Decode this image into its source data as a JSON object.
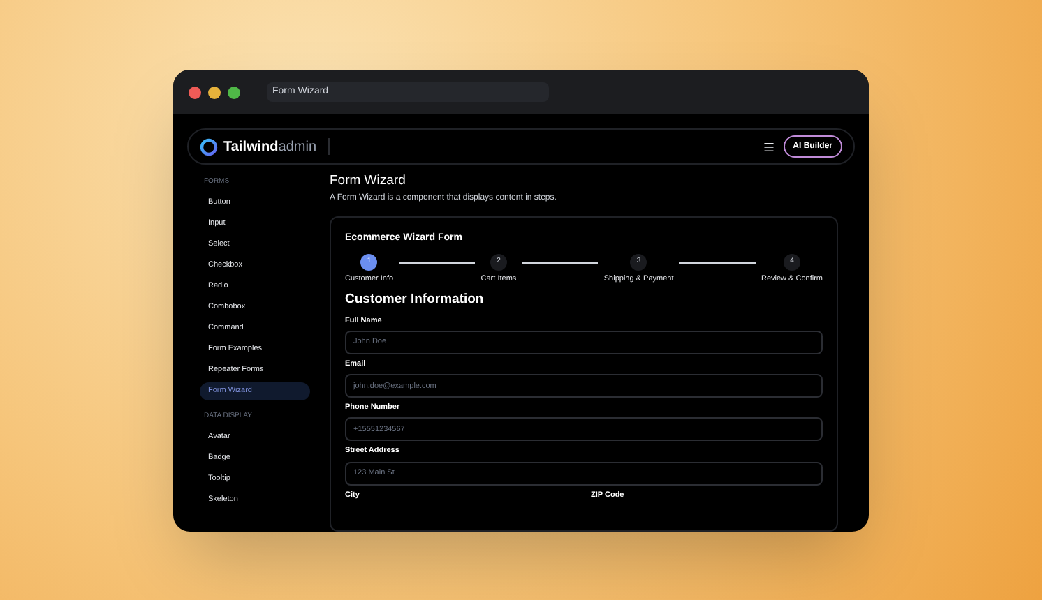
{
  "window": {
    "title": "Form Wizard"
  },
  "header": {
    "logo_bold": "Tailwind",
    "logo_light": "admin",
    "button": "AI Builder"
  },
  "sidebar": {
    "sections": [
      {
        "heading": "FORMS",
        "items": [
          {
            "label": "Button",
            "selected": false
          },
          {
            "label": "Input",
            "selected": false
          },
          {
            "label": "Select",
            "selected": false
          },
          {
            "label": "Checkbox",
            "selected": false
          },
          {
            "label": "Radio",
            "selected": false
          },
          {
            "label": "Combobox",
            "selected": false
          },
          {
            "label": "Command",
            "selected": false
          },
          {
            "label": "Form Examples",
            "selected": false
          },
          {
            "label": "Repeater Forms",
            "selected": false
          },
          {
            "label": "Form Wizard",
            "selected": true
          }
        ]
      },
      {
        "heading": "DATA DISPLAY",
        "items": [
          {
            "label": "Avatar",
            "selected": false
          },
          {
            "label": "Badge",
            "selected": false
          },
          {
            "label": "Tooltip",
            "selected": false
          },
          {
            "label": "Skeleton",
            "selected": false
          }
        ]
      }
    ]
  },
  "page": {
    "title": "Form Wizard",
    "description": "A Form Wizard is a component that displays content in steps."
  },
  "wizard": {
    "title": "Ecommerce Wizard Form",
    "steps": [
      {
        "number": "1",
        "label": "Customer Info",
        "selected": true
      },
      {
        "number": "2",
        "label": "Cart Items",
        "selected": false
      },
      {
        "number": "3",
        "label": "Shipping & Payment",
        "selected": false
      },
      {
        "number": "4",
        "label": "Review & Confirm",
        "selected": false
      }
    ],
    "section_title": "Customer Information",
    "fields": [
      {
        "label": "Full Name",
        "placeholder": "John Doe"
      },
      {
        "label": "Email",
        "placeholder": "john.doe@example.com"
      },
      {
        "label": "Phone Number",
        "placeholder": "+15551234567"
      },
      {
        "label": "Street Address",
        "placeholder": "123 Main St"
      }
    ],
    "half_fields": [
      {
        "label": "City"
      },
      {
        "label": "ZIP Code"
      }
    ]
  }
}
